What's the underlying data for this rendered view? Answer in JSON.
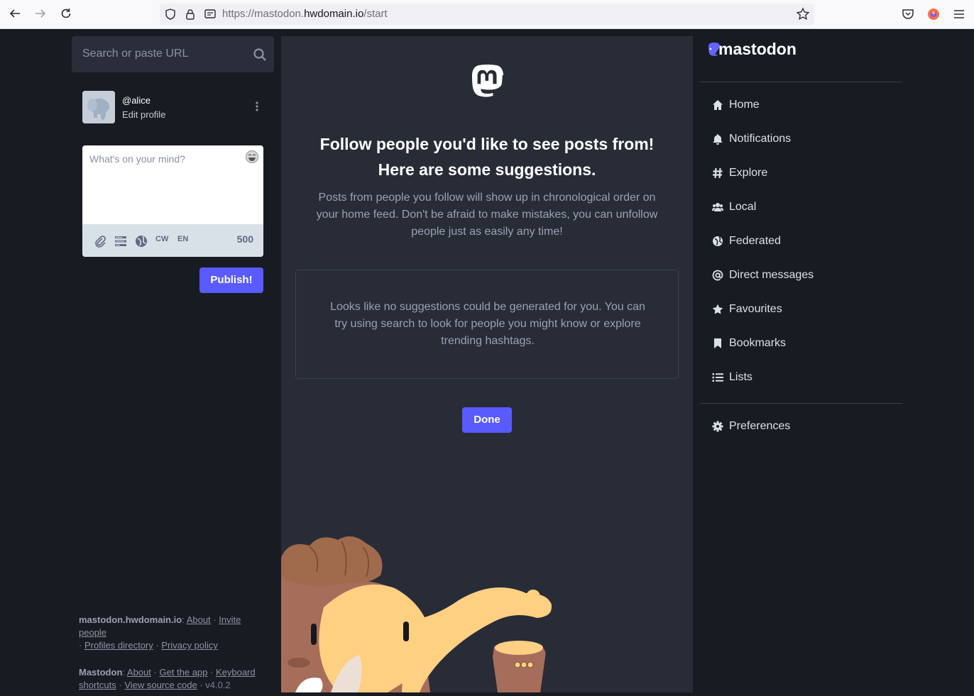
{
  "browser": {
    "url_prefix": "https://mastodon.",
    "url_domain": "hwdomain.io",
    "url_path": "/start"
  },
  "search": {
    "placeholder": "Search or paste URL"
  },
  "account": {
    "handle": "@alice",
    "edit_label": "Edit profile"
  },
  "composer": {
    "placeholder": "What's on your mind?",
    "cw_label": "CW",
    "lang_label": "EN",
    "char_count": "500",
    "publish_label": "Publish!"
  },
  "footer": {
    "domain": "mastodon.hwdomain.io",
    "about": "About",
    "invite": "Invite people",
    "profiles": "Profiles directory",
    "privacy": "Privacy policy",
    "mastodon": "Mastodon",
    "about2": "About",
    "get_app": "Get the app",
    "keyboard": "Keyboard shortcuts",
    "source": "View source code",
    "version": "v4.0.2"
  },
  "center": {
    "headline_1": "Follow people you'd like to see posts from!",
    "headline_2": "Here are some suggestions.",
    "lead": "Posts from people you follow will show up in chronological order on your home feed. Don't be afraid to make mistakes, you can unfollow people just as easily any time!",
    "empty_message": "Looks like no suggestions could be generated for you. You can try using search to look for people you might know or explore trending hashtags.",
    "done_label": "Done"
  },
  "brand": {
    "name": "mastodon"
  },
  "nav": {
    "items": [
      {
        "label": "Home",
        "icon": "home-icon"
      },
      {
        "label": "Notifications",
        "icon": "bell-icon"
      },
      {
        "label": "Explore",
        "icon": "hashtag-icon"
      },
      {
        "label": "Local",
        "icon": "users-icon"
      },
      {
        "label": "Federated",
        "icon": "globe-icon"
      },
      {
        "label": "Direct messages",
        "icon": "at-icon"
      },
      {
        "label": "Favourites",
        "icon": "star-icon"
      },
      {
        "label": "Bookmarks",
        "icon": "bookmark-icon"
      },
      {
        "label": "Lists",
        "icon": "list-icon"
      }
    ],
    "preferences": "Preferences"
  },
  "colors": {
    "accent": "#595aff",
    "bg": "#191b22",
    "panel": "#282c37"
  }
}
